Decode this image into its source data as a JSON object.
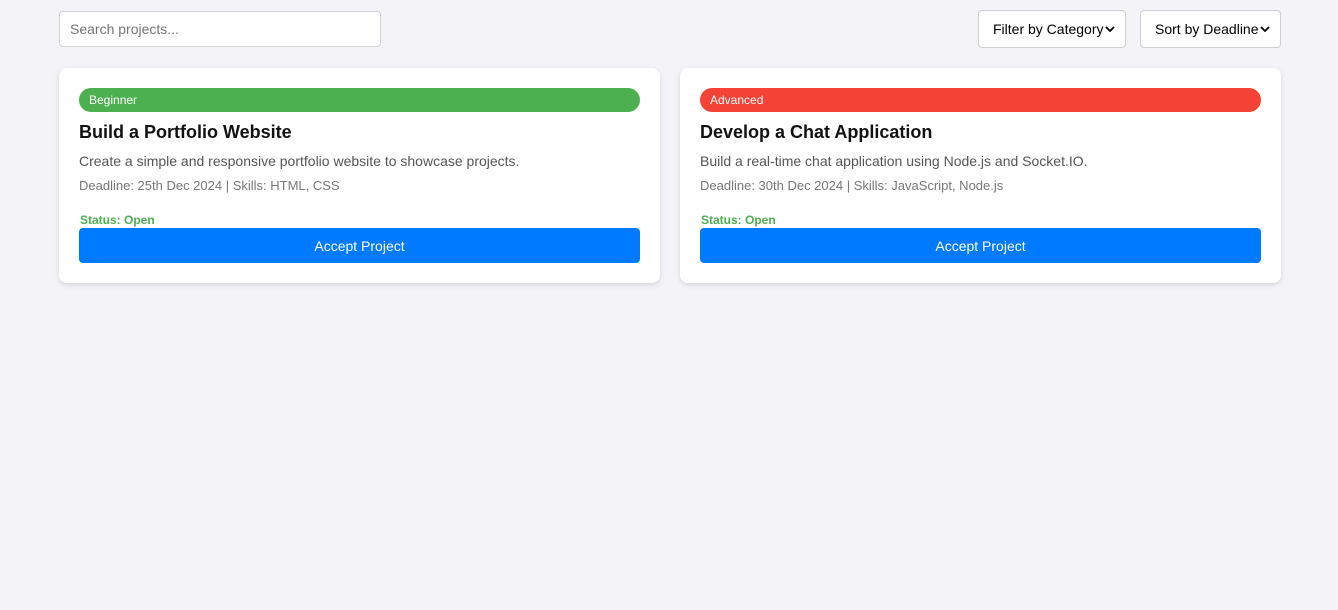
{
  "search": {
    "placeholder": "Search projects..."
  },
  "filters": {
    "category_label": "Filter by Category",
    "sort_label": "Sort by Deadline"
  },
  "projects": [
    {
      "level": "Beginner",
      "level_color": "#4caf50",
      "title": "Build a Portfolio Website",
      "description": "Create a simple and responsive portfolio website to showcase projects.",
      "meta": "Deadline: 25th Dec 2024 | Skills: HTML, CSS",
      "status": "Status: Open",
      "action_label": "Accept Project"
    },
    {
      "level": "Advanced",
      "level_color": "#f44336",
      "title": "Develop a Chat Application",
      "description": "Build a real-time chat application using Node.js and Socket.IO.",
      "meta": "Deadline: 30th Dec 2024 | Skills: JavaScript, Node.js",
      "status": "Status: Open",
      "action_label": "Accept Project"
    }
  ],
  "colors": {
    "primary": "#007bff",
    "status_open": "#4caf50",
    "background": "#f4f4f8"
  }
}
